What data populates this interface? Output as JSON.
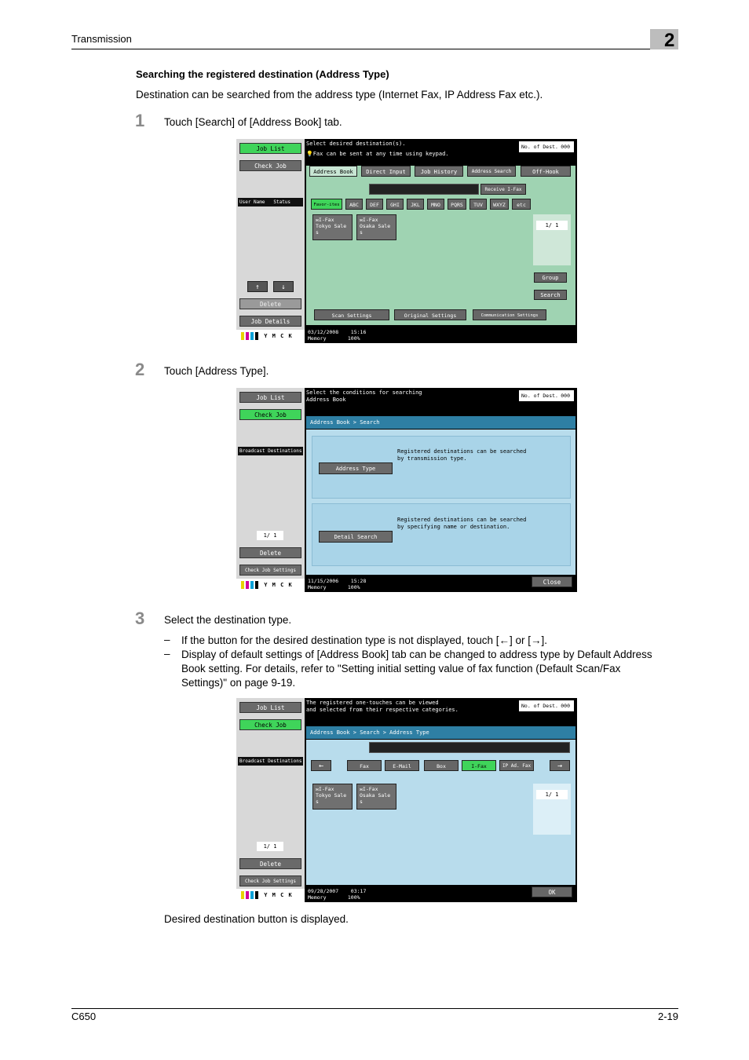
{
  "header": {
    "title": "Transmission",
    "chapter": "2"
  },
  "section": {
    "title": "Searching the registered destination (Address Type)",
    "intro": "Destination can be searched from the address type (Internet Fax, IP Address Fax etc.)."
  },
  "steps": [
    {
      "num": "1",
      "text": "Touch [Search] of [Address Book] tab."
    },
    {
      "num": "2",
      "text": "Touch [Address Type]."
    },
    {
      "num": "3",
      "text": "Select the destination type."
    }
  ],
  "bullets": [
    "If the button for the desired destination type is not displayed, touch [←] or [→].",
    "Display of default settings of [Address Book] tab can be changed to address type by Default Address Book setting. For details, refer to \"Setting initial setting value of fax function (Default Scan/Fax Settings)\" on page 9-19."
  ],
  "dash": "–",
  "result": "Desired destination button is displayed.",
  "footer": {
    "model": "C650",
    "page": "2-19"
  },
  "shot1": {
    "job_list": "Job List",
    "check_job": "Check Job",
    "user_name": "User Name",
    "status": "Status",
    "up": "↑",
    "down": "↓",
    "delete": "Delete",
    "job_details": "Job Details",
    "message": "Select desired destination(s).",
    "message2": "💡Fax can be sent at any time using keypad.",
    "no_dest": "No. of Dest.",
    "count": "000",
    "tabs": [
      "Address Book",
      "Direct Input",
      "Job History",
      "Address Search",
      "Off-Hook"
    ],
    "receive": "Receive I-Fax",
    "index": [
      "Favor-ites",
      "ABC",
      "DEF",
      "GHI",
      "JKL",
      "MNO",
      "PQRS",
      "TUV",
      "WXYZ",
      "etc"
    ],
    "dests": [
      {
        "icon": "✉",
        "line1": "I-Fax",
        "line2": "Tokyo Sale",
        "line3": "s"
      },
      {
        "icon": "✉",
        "line1": "I-Fax",
        "line2": "Osaka Sale",
        "line3": "s"
      }
    ],
    "pager": "1/  1",
    "group": "Group",
    "search": "Search",
    "scan_settings": "Scan Settings",
    "original_settings": "Original Settings",
    "comm_settings": "Communication Settings",
    "date": "03/12/2008",
    "time": "15:16",
    "memory": "Memory",
    "mem_pct": "100%",
    "toner": "Y M C K"
  },
  "shot2": {
    "job_list": "Job List",
    "check_job": "Check Job",
    "broadcast": "Broadcast Destinations",
    "pager": "1/  1",
    "delete": "Delete",
    "check_job_settings": "Check Job Settings",
    "message": "Select the conditions for searching",
    "message2": "Address Book",
    "no_dest": "No. of Dest.",
    "count": "000",
    "crumb": "Address Book > Search",
    "addr_type": "Address Type",
    "addr_type_desc1": "Registered destinations can be searched",
    "addr_type_desc2": "by transmission type.",
    "detail_search": "Detail Search",
    "detail_desc1": "Registered destinations can be searched",
    "detail_desc2": "by specifying name or destination.",
    "close": "Close",
    "date": "11/15/2006",
    "time": "15:28",
    "memory": "Memory",
    "mem_pct": "100%",
    "toner": "Y M C K"
  },
  "shot3": {
    "job_list": "Job List",
    "check_job": "Check Job",
    "broadcast": "Broadcast Destinations",
    "pager_left": "1/  1",
    "delete": "Delete",
    "check_job_settings": "Check Job Settings",
    "message": "The registered one-touches can be viewed",
    "message2": "and selected from their respective categories.",
    "no_dest": "No. of Dest.",
    "count": "000",
    "crumb": "Address Book > Search > Address Type",
    "left": "←",
    "right": "→",
    "types": [
      "Fax",
      "E-Mail",
      "Box",
      "I-Fax",
      "IP Ad. Fax"
    ],
    "dests": [
      {
        "icon": "✉",
        "line1": "I-Fax",
        "line2": "Tokyo Sale",
        "line3": "s"
      },
      {
        "icon": "✉",
        "line1": "I-Fax",
        "line2": "Osaka Sale",
        "line3": "s"
      }
    ],
    "pager": "1/  1",
    "ok": "OK",
    "date": "09/28/2007",
    "time": "03:17",
    "memory": "Memory",
    "mem_pct": "100%",
    "toner": "Y M C K"
  }
}
